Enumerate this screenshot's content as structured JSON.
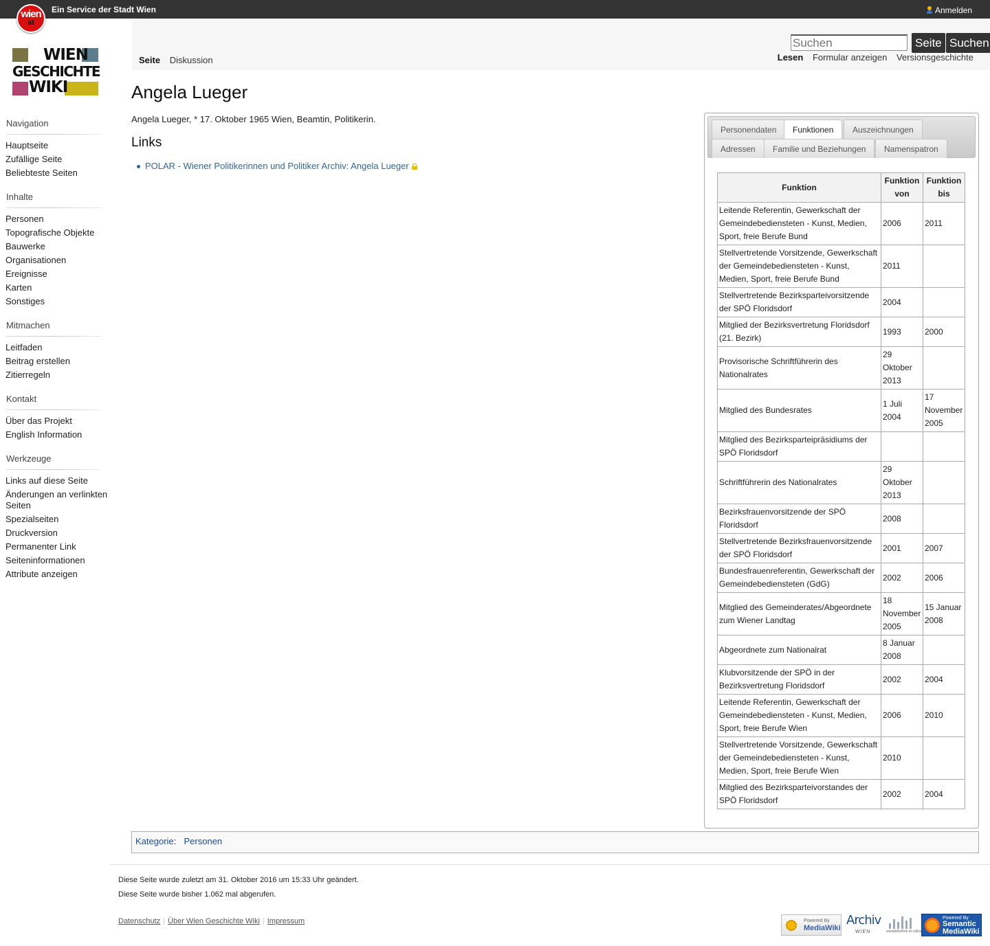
{
  "topbar": {
    "badge_top": "wien",
    "badge_bottom": "at",
    "service": "Ein Service der Stadt Wien",
    "login": "Anmelden"
  },
  "logo": {
    "line1": "WIEN",
    "line2": "GESCHICHTE",
    "line3": "WIKI",
    "colors": [
      "#7a7344",
      "#5c7d8e",
      "#b0446f",
      "#c9b41a"
    ]
  },
  "sidebar": [
    {
      "title": "Navigation",
      "items": [
        "Hauptseite",
        "Zufällige Seite",
        "Beliebteste Seiten"
      ]
    },
    {
      "title": "Inhalte",
      "items": [
        "Personen",
        "Topografische Objekte",
        "Bauwerke",
        "Organisationen",
        "Ereignisse",
        "Karten",
        "Sonstiges"
      ]
    },
    {
      "title": "Mitmachen",
      "items": [
        "Leitfaden",
        "Beitrag erstellen",
        "Zitierregeln"
      ]
    },
    {
      "title": "Kontakt",
      "items": [
        "Über das Projekt",
        "English Information"
      ]
    },
    {
      "title": "Werkzeuge",
      "items": [
        "Links auf diese Seite",
        "Änderungen an verlinkten Seiten",
        "Spezialseiten",
        "Druckversion",
        "Permanenter Link",
        "Seiteninformationen",
        "Attribute anzeigen"
      ]
    }
  ],
  "tabs_left": [
    "Seite",
    "Diskussion"
  ],
  "search": {
    "placeholder": "Suchen",
    "go_label": "Seite",
    "search_label": "Suchen"
  },
  "tabs_right": [
    "Lesen",
    "Formular anzeigen",
    "Versionsgeschichte"
  ],
  "page": {
    "title": "Angela Lueger",
    "intro": "Angela Lueger, * 17. Oktober 1965 Wien, Beamtin, Politikerin.",
    "links_heading": "Links",
    "links": [
      "POLAR - Wiener Politikerinnen und Politiker Archiv: Angela Lueger"
    ]
  },
  "infobox": {
    "tabs_row1": [
      "Personendaten",
      "Funktionen",
      "Auszeichnungen"
    ],
    "tabs_row2": [
      "Adressen",
      "Familie und Beziehungen",
      "Namenspatron"
    ],
    "active_tab": "Funktionen",
    "headers": [
      "Funktion",
      "Funktion von",
      "Funktion bis"
    ],
    "rows": [
      [
        "Leitende Referentin, Gewerkschaft der Gemeindebediensteten - Kunst, Medien, Sport, freie Berufe Bund",
        "2006",
        "2011"
      ],
      [
        "Stellvertretende Vorsitzende, Gewerkschaft der Gemeindebediensteten - Kunst, Medien, Sport, freie Berufe Bund",
        "2011",
        ""
      ],
      [
        "Stellvertretende Bezirksparteivorsitzende der SPÖ Floridsdorf",
        "2004",
        ""
      ],
      [
        "Mitglied der Bezirksvertretung Floridsdorf (21. Bezirk)",
        "1993",
        "2000"
      ],
      [
        "Provisorische Schriftführerin des Nationalrates",
        "29 Oktober 2013",
        ""
      ],
      [
        "Mitglied des Bundesrates",
        "1 Juli 2004",
        "17 November 2005"
      ],
      [
        "Mitglied des Bezirksparteipräsidiums der SPÖ Floridsdorf",
        "",
        ""
      ],
      [
        "Schriftführerin des Nationalrates",
        "29 Oktober 2013",
        ""
      ],
      [
        "Bezirksfrauenvorsitzende der SPÖ Floridsdorf",
        "2008",
        ""
      ],
      [
        "Stellvertretende Bezirksfrauenvorsitzende der SPÖ Floridsdorf",
        "2001",
        "2007"
      ],
      [
        "Bundesfrauenreferentin, Gewerkschaft der Gemeindebediensteten (GdG)",
        "2002",
        "2006"
      ],
      [
        "Mitglied des Gemeinderates/Abgeordnete zum Wiener Landtag",
        "18 November 2005",
        "15 Januar 2008"
      ],
      [
        "Abgeordnete zum Nationalrat",
        "8 Januar 2008",
        ""
      ],
      [
        "Klubvorsitzende der SPÖ in der Bezirksvertretung Floridsdorf",
        "2002",
        "2004"
      ],
      [
        "Leitende Referentin, Gewerkschaft der Gemeindebediensteten - Kunst, Medien, Sport, freie Berufe Wien",
        "2006",
        "2010"
      ],
      [
        "Stellvertretende Vorsitzende, Gewerkschaft der Gemeindebediensteten - Kunst, Medien, Sport, freie Berufe Wien",
        "2010",
        ""
      ],
      [
        "Mitglied des Bezirksparteivorstandes der SPÖ Floridsdorf",
        "2002",
        "2004"
      ]
    ]
  },
  "category": {
    "label": "Kategorie",
    "items": [
      "Personen"
    ]
  },
  "footer": {
    "last_modified": "Diese Seite wurde zuletzt am 31. Oktober 2016 um 15:33 Uhr geändert.",
    "views": "Diese Seite wurde bisher 1.062 mal abgerufen.",
    "links": [
      "Datenschutz",
      "Über Wien Geschichte Wiki",
      "Impressum"
    ],
    "badges": {
      "mediawiki": {
        "line1": "Powered By",
        "line2": "MediaWiki"
      },
      "archiv": {
        "line1": "Archiv",
        "line2": "WIEN"
      },
      "bibliothek": {
        "line1": "wienbibliothek im rathaus"
      },
      "smw": {
        "line1": "Powered By",
        "line2": "Semantic",
        "line3": "MediaWiki"
      }
    }
  }
}
